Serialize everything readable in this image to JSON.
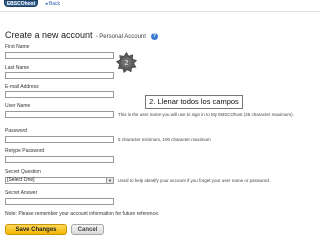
{
  "top_bar": {
    "logo_text": "EBSCOhost",
    "back_label": "◂ Back"
  },
  "header": {
    "title": "Create a new account",
    "subtitle": "- Personal Account",
    "help_icon": "help-icon"
  },
  "form": {
    "first_name": {
      "label": "First Name",
      "value": ""
    },
    "last_name": {
      "label": "Last Name",
      "value": ""
    },
    "email": {
      "label": "E-mail Address",
      "value": ""
    },
    "user_name": {
      "label": "User Name",
      "value": "",
      "hint": "This is the user name you will use to sign in to My EBSCOhost (45 character maximum)."
    },
    "password": {
      "label": "Password",
      "value": "",
      "hint": "5 character minimum, 100 character maximum"
    },
    "retype_password": {
      "label": "Retype Password",
      "value": ""
    },
    "secret_question": {
      "label": "Secret Question",
      "selected": "[Select One]",
      "hint": "Used to help identify your account if you forget your user name or password."
    },
    "secret_answer": {
      "label": "Secret Answer",
      "value": ""
    },
    "note": "Note: Please remember your account information for future reference."
  },
  "buttons": {
    "save": "Save Changes",
    "cancel": "Cancel"
  },
  "overlay": {
    "step_marker": "2",
    "callout": "2. Llenar todos los campos"
  },
  "colors": {
    "accent_link": "#2a5db0",
    "save_button": "#f2b705",
    "help_icon": "#3a7bd5"
  }
}
